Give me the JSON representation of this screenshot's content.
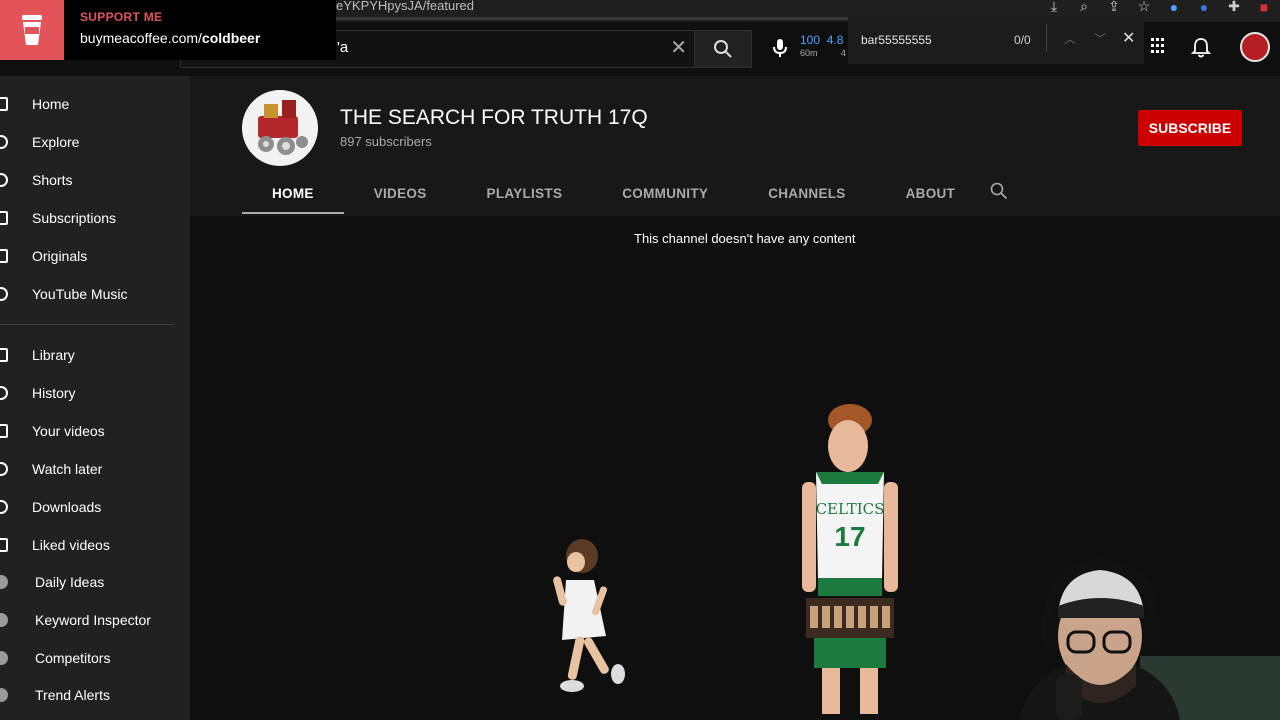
{
  "browser": {
    "url_fragment": "eYKPYHpysJA/featured"
  },
  "search": {
    "value": "'a",
    "clear_glyph": "✕"
  },
  "stats": {
    "value1": "100",
    "unit1": "60m",
    "value2": "4.8",
    "unit2": "4"
  },
  "find_bar": {
    "query": "bar55555555",
    "count": "0/0",
    "up": "︿",
    "down": "﹀",
    "close": "✕"
  },
  "support": {
    "title": "SUPPORT ME",
    "url_prefix": "buymeacoffee.com/",
    "url_handle": "coldbeer"
  },
  "sidebar": {
    "items": [
      {
        "label": "Home",
        "icon": "home-icon"
      },
      {
        "label": "Explore",
        "icon": "compass-icon"
      },
      {
        "label": "Shorts",
        "icon": "shorts-icon"
      },
      {
        "label": "Subscriptions",
        "icon": "subscriptions-icon"
      },
      {
        "label": "Originals",
        "icon": "originals-icon"
      },
      {
        "label": "YouTube Music",
        "icon": "music-icon"
      },
      {
        "label": "Library",
        "icon": "library-icon"
      },
      {
        "label": "History",
        "icon": "history-icon"
      },
      {
        "label": "Your videos",
        "icon": "your-videos-icon"
      },
      {
        "label": "Watch later",
        "icon": "clock-icon"
      },
      {
        "label": "Downloads",
        "icon": "download-icon"
      },
      {
        "label": "Liked videos",
        "icon": "thumbs-up-icon"
      },
      {
        "label": "Daily Ideas",
        "icon": "vidiq-icon"
      },
      {
        "label": "Keyword Inspector",
        "icon": "vidiq-icon"
      },
      {
        "label": "Competitors",
        "icon": "vidiq-icon"
      },
      {
        "label": "Trend Alerts",
        "icon": "vidiq-icon"
      }
    ]
  },
  "channel": {
    "name": "THE SEARCH FOR TRUTH 17Q",
    "subscribers": "897 subscribers",
    "subscribe_label": "SUBSCRIBE",
    "tabs": [
      "HOME",
      "VIDEOS",
      "PLAYLISTS",
      "COMMUNITY",
      "CHANNELS",
      "ABOUT"
    ],
    "empty_message": "This channel doesn't have any content"
  },
  "colors": {
    "subscribe": "#cc0000",
    "support_accent": "#e2545a",
    "sidebar_bg": "#212121",
    "page_bg": "#0f0f0f"
  }
}
